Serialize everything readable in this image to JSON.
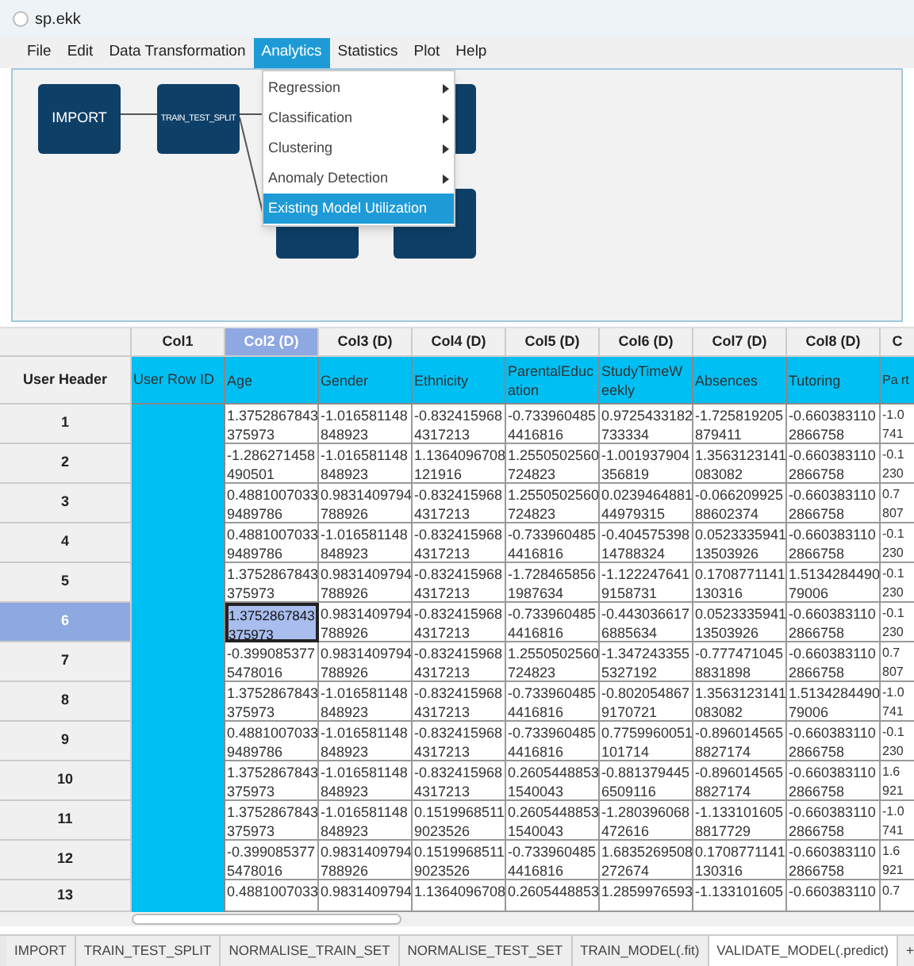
{
  "window": {
    "title": "sp.ekk"
  },
  "menubar": [
    {
      "label": "File",
      "selected": false
    },
    {
      "label": "Edit",
      "selected": false
    },
    {
      "label": "Data Transformation",
      "selected": false
    },
    {
      "label": "Analytics",
      "selected": true
    },
    {
      "label": "Statistics",
      "selected": false
    },
    {
      "label": "Plot",
      "selected": false
    },
    {
      "label": "Help",
      "selected": false
    }
  ],
  "menu": [
    {
      "label": "Regression",
      "submenu": true,
      "selected": false
    },
    {
      "label": "Classification",
      "submenu": true,
      "selected": false
    },
    {
      "label": "Clustering",
      "submenu": true,
      "selected": false
    },
    {
      "label": "Anomaly Detection",
      "submenu": true,
      "selected": false
    },
    {
      "label": "Existing Model Utilization",
      "submenu": false,
      "selected": true
    }
  ],
  "canvas": {
    "nodes": [
      {
        "label": "IMPORT"
      },
      {
        "label": "TRAIN_TEST_SPLIT"
      }
    ]
  },
  "table": {
    "corner": "User Header",
    "row_id_label": "User Row ID",
    "columns": [
      {
        "header": "Col2 (D)",
        "name": "Age",
        "selected": true
      },
      {
        "header": "Col3 (D)",
        "name": "Gender",
        "selected": false
      },
      {
        "header": "Col4 (D)",
        "name": "Ethnicity",
        "selected": false
      },
      {
        "header": "Col5 (D)",
        "name": "ParentalEducation",
        "selected": false
      },
      {
        "header": "Col6 (D)",
        "name": "StudyTimeWeekly",
        "selected": false
      },
      {
        "header": "Col7 (D)",
        "name": "Absences",
        "selected": false
      },
      {
        "header": "Col8 (D)",
        "name": "Tutoring",
        "selected": false
      },
      {
        "header": "C",
        "name": "Pa rt",
        "selected": false
      }
    ],
    "id_header": "Col1",
    "rows": [
      {
        "label": "1",
        "selected": false,
        "cells": [
          "1.3752867843375973",
          "-1.016581148848923",
          "-0.8324159684317213",
          "-0.7339604854416816",
          "0.9725433182733334",
          "-1.725819205879411",
          "-0.6603831102866758",
          "-1.0 741"
        ]
      },
      {
        "label": "2",
        "selected": false,
        "cells": [
          "-1.286271458490501",
          "-1.016581148848923",
          "1.1364096708121916",
          "1.2550502560724823",
          "-1.001937904356819",
          "1.3563123141083082",
          "-0.6603831102866758",
          "-0.1 230"
        ]
      },
      {
        "label": "3",
        "selected": false,
        "cells": [
          "0.48810070339489786",
          "0.9831409794788926",
          "-0.8324159684317213",
          "1.2550502560724823",
          "0.023946488144979315",
          "-0.06620992588602374",
          "-0.6603831102866758",
          "0.7 807"
        ]
      },
      {
        "label": "4",
        "selected": false,
        "cells": [
          "0.48810070339489786",
          "-1.016581148848923",
          "-0.8324159684317213",
          "-0.7339604854416816",
          "-0.40457539814788324",
          "0.052333594113503926",
          "-0.6603831102866758",
          "-0.1 230"
        ]
      },
      {
        "label": "5",
        "selected": false,
        "cells": [
          "1.3752867843375973",
          "0.9831409794788926",
          "-0.8324159684317213",
          "-1.7284658561987634",
          "-1.1222476419158731",
          "0.1708771141130316",
          "1.513428449079006",
          "-0.1 230"
        ]
      },
      {
        "label": "6",
        "selected": true,
        "cells": [
          "1.3752867843375973",
          "0.9831409794788926",
          "-0.8324159684317213",
          "-0.7339604854416816",
          "-0.4430366176885634",
          "0.052333594113503926",
          "-0.6603831102866758",
          "-0.1 230"
        ]
      },
      {
        "label": "7",
        "selected": false,
        "cells": [
          "-0.3990853775478016",
          "0.9831409794788926",
          "-0.8324159684317213",
          "1.2550502560724823",
          "-1.3472433555327192",
          "-0.7774710458831898",
          "-0.6603831102866758",
          "0.7 807"
        ]
      },
      {
        "label": "8",
        "selected": false,
        "cells": [
          "1.3752867843375973",
          "-1.016581148848923",
          "-0.8324159684317213",
          "-0.7339604854416816",
          "-0.8020548679170721",
          "1.3563123141083082",
          "1.513428449079006",
          "-1.0 741"
        ]
      },
      {
        "label": "9",
        "selected": false,
        "cells": [
          "0.48810070339489786",
          "-1.016581148848923",
          "-0.8324159684317213",
          "-0.7339604854416816",
          "0.7759960051101714",
          "-0.8960145658827174",
          "-0.6603831102866758",
          "-0.1 230"
        ]
      },
      {
        "label": "10",
        "selected": false,
        "cells": [
          "1.3752867843375973",
          "-1.016581148848923",
          "-0.8324159684317213",
          "0.26054488531540043",
          "-0.8813794456509116",
          "-0.8960145658827174",
          "-0.6603831102866758",
          "1.6 921"
        ]
      },
      {
        "label": "11",
        "selected": false,
        "cells": [
          "1.3752867843375973",
          "-1.016581148848923",
          "0.15199685119023526",
          "0.26054488531540043",
          "-1.280396068472616",
          "-1.1331016058817729",
          "-0.6603831102866758",
          "-1.0 741"
        ]
      },
      {
        "label": "12",
        "selected": false,
        "cells": [
          "-0.3990853775478016",
          "0.9831409794788926",
          "0.15199685119023526",
          "-0.7339604854416816",
          "1.6835269508272674",
          "0.1708771141130316",
          "-0.6603831102866758",
          "1.6 921"
        ]
      },
      {
        "label": "13",
        "selected": false,
        "cells": [
          "0.4881007033",
          "0.9831409794",
          "1.1364096708",
          "0.2605448853",
          "1.2859976593",
          "-1.133101605",
          "-0.660383110",
          "0.7"
        ]
      }
    ]
  },
  "tabs": [
    {
      "label": "IMPORT",
      "selected": false
    },
    {
      "label": "TRAIN_TEST_SPLIT",
      "selected": false
    },
    {
      "label": "NORMALISE_TRAIN_SET",
      "selected": false
    },
    {
      "label": "NORMALISE_TEST_SET",
      "selected": false
    },
    {
      "label": "TRAIN_MODEL(.fit)",
      "selected": false
    },
    {
      "label": "VALIDATE_MODEL(.predict)",
      "selected": true
    },
    {
      "label": "+",
      "selected": false
    }
  ]
}
